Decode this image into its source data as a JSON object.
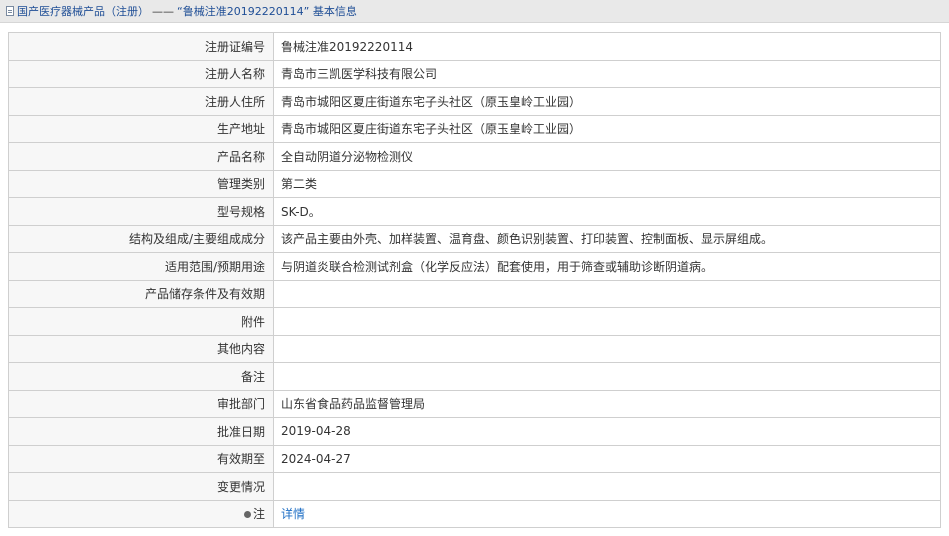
{
  "breadcrumb": {
    "root": "国产医疗器械产品（注册）",
    "separator": "——",
    "current": "“鲁械注准20192220114” 基本信息"
  },
  "rows": [
    {
      "label": "注册证编号",
      "value": "鲁械注准20192220114"
    },
    {
      "label": "注册人名称",
      "value": "青岛市三凯医学科技有限公司"
    },
    {
      "label": "注册人住所",
      "value": "青岛市城阳区夏庄街道东宅子头社区（原玉皇岭工业园）"
    },
    {
      "label": "生产地址",
      "value": "青岛市城阳区夏庄街道东宅子头社区（原玉皇岭工业园）"
    },
    {
      "label": "产品名称",
      "value": "全自动阴道分泌物检测仪"
    },
    {
      "label": "管理类别",
      "value": "第二类"
    },
    {
      "label": "型号规格",
      "value": "SK-D。"
    },
    {
      "label": "结构及组成/主要组成成分",
      "value": "该产品主要由外壳、加样装置、温育盘、颜色识别装置、打印装置、控制面板、显示屏组成。"
    },
    {
      "label": "适用范围/预期用途",
      "value": "与阴道炎联合检测试剂盒（化学反应法）配套使用，用于筛查或辅助诊断阴道病。"
    },
    {
      "label": "产品储存条件及有效期",
      "value": ""
    },
    {
      "label": "附件",
      "value": ""
    },
    {
      "label": "其他内容",
      "value": ""
    },
    {
      "label": "备注",
      "value": ""
    },
    {
      "label": "审批部门",
      "value": "山东省食品药品监督管理局"
    },
    {
      "label": "批准日期",
      "value": "2019-04-28"
    },
    {
      "label": "有效期至",
      "value": "2024-04-27"
    },
    {
      "label": "变更情况",
      "value": ""
    }
  ],
  "note_row": {
    "label": "注",
    "icon": "bulb-icon",
    "link": "详情"
  }
}
